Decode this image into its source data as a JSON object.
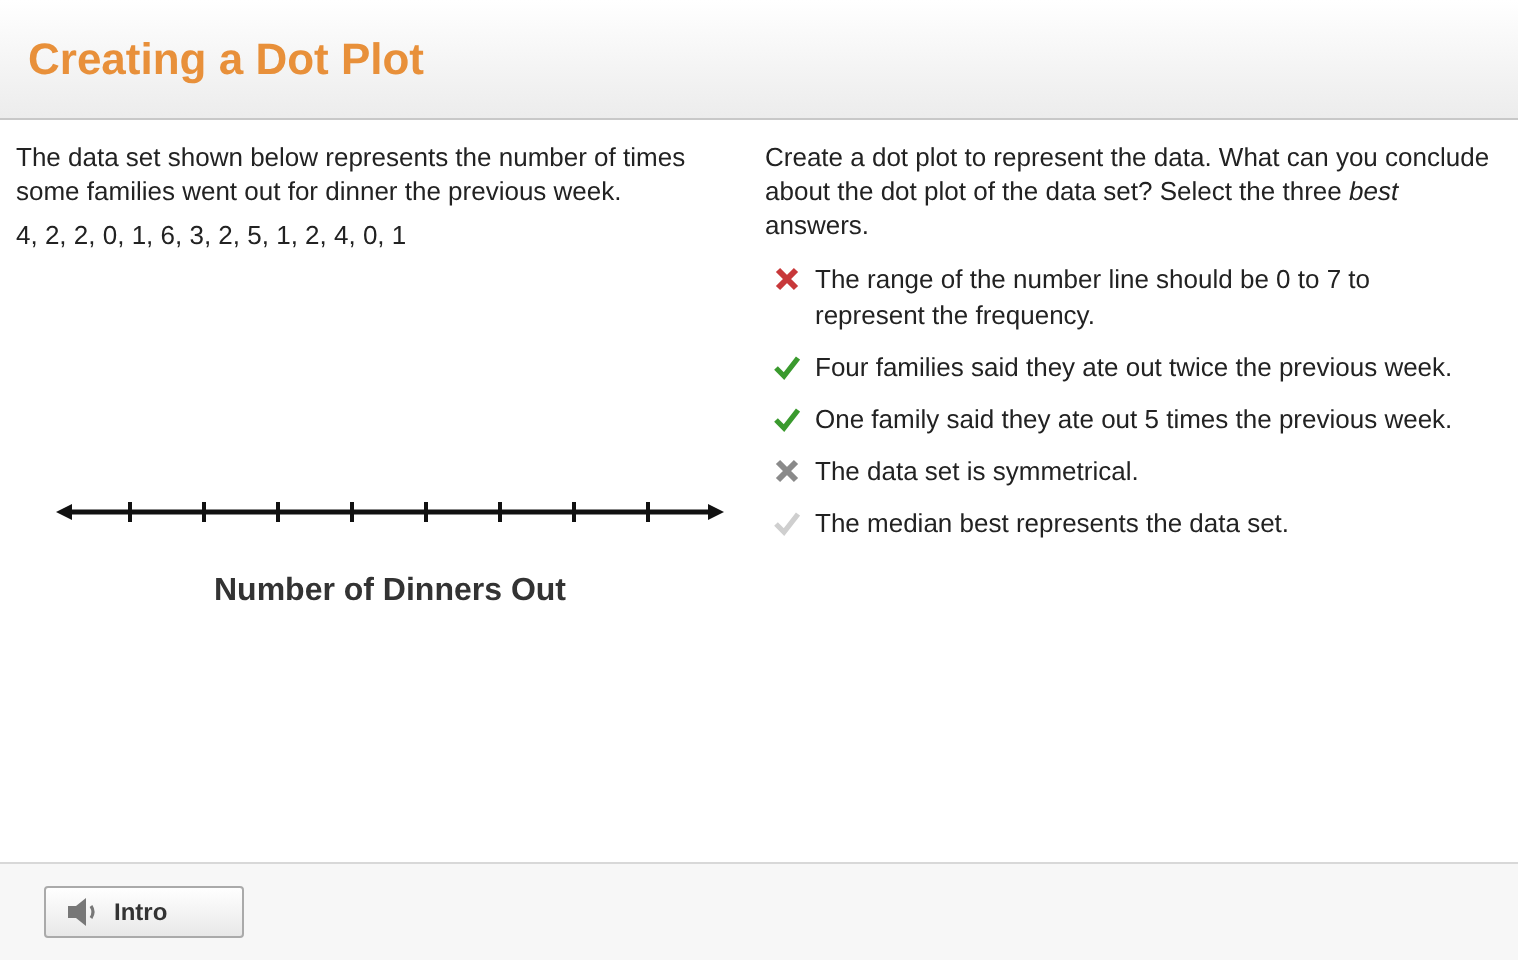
{
  "title": "Creating a Dot Plot",
  "prompt": "The data set shown below represents the number of times some families went out for dinner the previous week.",
  "data_values": "4, 2, 2, 0, 1, 6, 3, 2, 5, 1, 2, 4, 0, 1",
  "number_line": {
    "label": "Number of Dinners Out"
  },
  "question": "Create a dot plot to represent the data. What can you conclude about the dot plot of the data set? Select the three *best* answers.",
  "options": [
    {
      "text": "The range of the number line should be 0 to 7 to represent the frequency.",
      "selected": true,
      "correct": false
    },
    {
      "text": "Four families said they ate out twice the previous week.",
      "selected": true,
      "correct": true
    },
    {
      "text": "One family said they ate out 5 times the previous week.",
      "selected": true,
      "correct": true
    },
    {
      "text": "The data set is symmetrical.",
      "selected": false,
      "correct": false
    },
    {
      "text": "The median best represents the data set.",
      "selected": false,
      "correct": true
    }
  ],
  "footer": {
    "intro_button": "Intro"
  }
}
